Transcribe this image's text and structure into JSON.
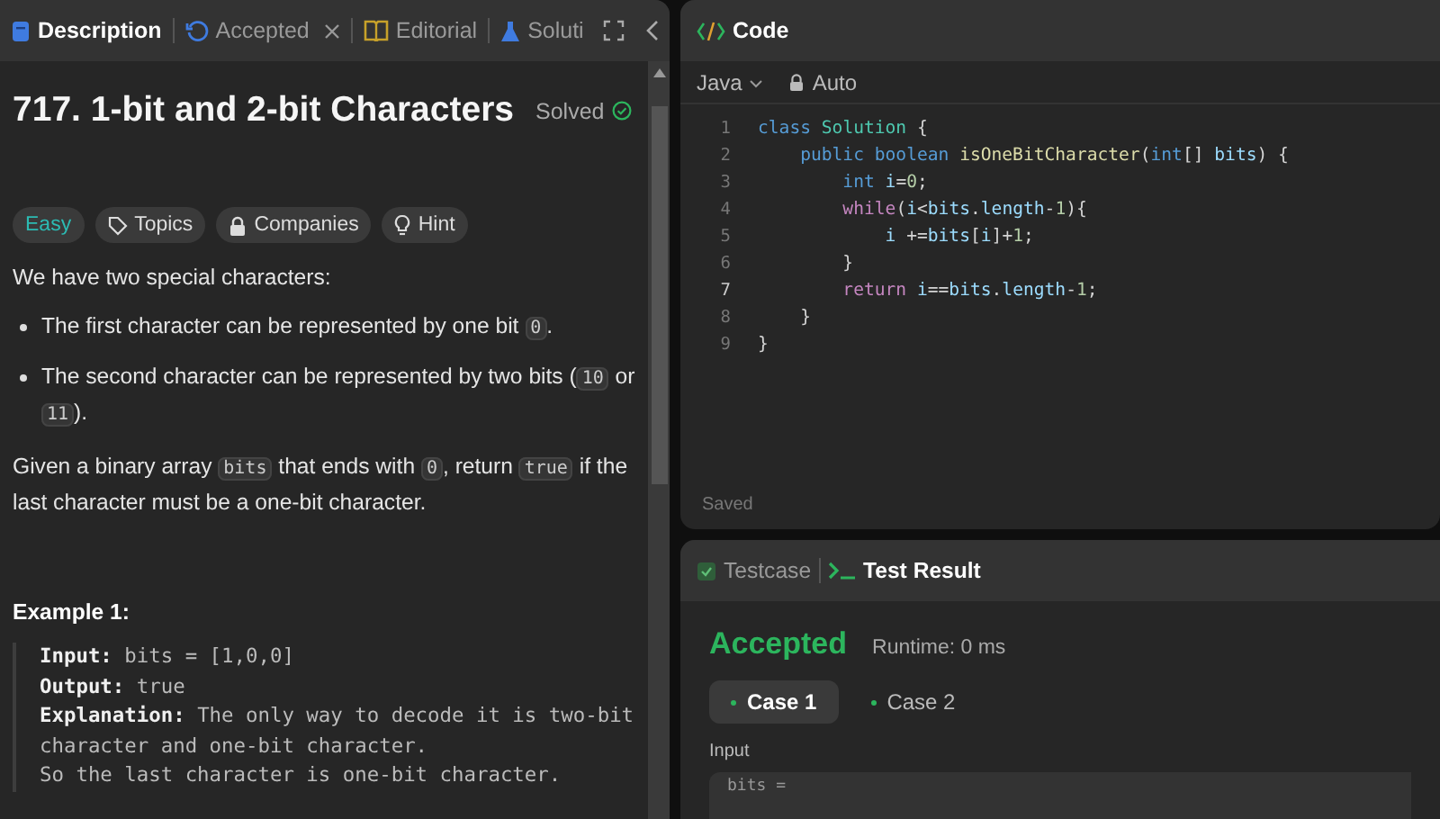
{
  "left_tabs": [
    {
      "label": "Description",
      "selected": true,
      "closable": false
    },
    {
      "label": "Accepted",
      "selected": false,
      "closable": true
    },
    {
      "label": "Editorial",
      "selected": false,
      "closable": false
    },
    {
      "label": "Soluti",
      "selected": false,
      "closable": false
    }
  ],
  "problem": {
    "title": "717. 1-bit and 2-bit Characters",
    "status": "Solved",
    "tags": [
      {
        "label": "Easy",
        "kind": "difficulty"
      },
      {
        "label": "Topics",
        "kind": "topics"
      },
      {
        "label": "Companies",
        "kind": "companies"
      },
      {
        "label": "Hint",
        "kind": "hint"
      }
    ],
    "intro": "We have two special characters:",
    "bullets": [
      [
        {
          "kind": "text",
          "text": "The first character can be represented by one bit "
        },
        {
          "kind": "code",
          "text": "0"
        },
        {
          "kind": "text",
          "text": "."
        }
      ],
      [
        {
          "kind": "text",
          "text": "The second character can be represented by two bits ("
        },
        {
          "kind": "code",
          "text": "10"
        },
        {
          "kind": "text",
          "text": " or "
        },
        {
          "kind": "code",
          "text": "11"
        },
        {
          "kind": "text",
          "text": ")."
        }
      ]
    ],
    "statement": [
      {
        "kind": "text",
        "text": "Given a binary array "
      },
      {
        "kind": "code",
        "text": "bits"
      },
      {
        "kind": "text",
        "text": " that ends with "
      },
      {
        "kind": "code",
        "text": "0"
      },
      {
        "kind": "text",
        "text": ", return "
      },
      {
        "kind": "code",
        "text": "true"
      },
      {
        "kind": "text",
        "text": " if the last character must be a one-bit character."
      }
    ],
    "example": {
      "title": "Example 1:",
      "lines": [
        "**Input:** bits = [1,0,0]",
        "**Output:** true",
        "**Explanation:** The only way to decode it is two-bit character and one-bit character.\nSo the last character is one-bit character."
      ]
    }
  },
  "code_panel": {
    "title": "Code",
    "language": "Java",
    "mode": "Auto",
    "status": "Saved",
    "lines": [
      {
        "number": "1",
        "current": false,
        "tokens": [
          {
            "kind": "keyword",
            "text": "class"
          },
          {
            "kind": "type",
            "text": " Solution"
          },
          {
            "kind": "plain",
            "text": " {"
          }
        ]
      },
      {
        "number": "2",
        "current": false,
        "tokens": [
          {
            "kind": "keyword",
            "text": "    public"
          },
          {
            "kind": "keyword",
            "text": " boolean"
          },
          {
            "kind": "func",
            "text": " isOneBitCharacter"
          },
          {
            "kind": "plain",
            "text": "("
          },
          {
            "kind": "keyword",
            "text": "int"
          },
          {
            "kind": "plain",
            "text": "[] "
          },
          {
            "kind": "var",
            "text": "bits"
          },
          {
            "kind": "plain",
            "text": ") {"
          }
        ]
      },
      {
        "number": "3",
        "current": false,
        "tokens": [
          {
            "kind": "keyword",
            "text": "        int"
          },
          {
            "kind": "var",
            "text": " i"
          },
          {
            "kind": "plain",
            "text": "="
          },
          {
            "kind": "number",
            "text": "0"
          },
          {
            "kind": "plain",
            "text": ";"
          }
        ]
      },
      {
        "number": "4",
        "current": false,
        "tokens": [
          {
            "kind": "control",
            "text": "        while"
          },
          {
            "kind": "plain",
            "text": "("
          },
          {
            "kind": "var",
            "text": "i"
          },
          {
            "kind": "plain",
            "text": "<"
          },
          {
            "kind": "var",
            "text": "bits"
          },
          {
            "kind": "plain",
            "text": "."
          },
          {
            "kind": "var",
            "text": "length"
          },
          {
            "kind": "plain",
            "text": "-"
          },
          {
            "kind": "number",
            "text": "1"
          },
          {
            "kind": "plain",
            "text": "){"
          }
        ]
      },
      {
        "number": "5",
        "current": false,
        "tokens": [
          {
            "kind": "var",
            "text": "            i"
          },
          {
            "kind": "plain",
            "text": " +="
          },
          {
            "kind": "var",
            "text": "bits"
          },
          {
            "kind": "plain",
            "text": "["
          },
          {
            "kind": "var",
            "text": "i"
          },
          {
            "kind": "plain",
            "text": "]+"
          },
          {
            "kind": "number",
            "text": "1"
          },
          {
            "kind": "plain",
            "text": ";"
          }
        ]
      },
      {
        "number": "6",
        "current": false,
        "tokens": [
          {
            "kind": "plain",
            "text": "        }"
          }
        ]
      },
      {
        "number": "7",
        "current": true,
        "tokens": [
          {
            "kind": "control",
            "text": "        return"
          },
          {
            "kind": "var",
            "text": " i"
          },
          {
            "kind": "plain",
            "text": "=="
          },
          {
            "kind": "var",
            "text": "bits"
          },
          {
            "kind": "plain",
            "text": "."
          },
          {
            "kind": "var",
            "text": "length"
          },
          {
            "kind": "plain",
            "text": "-"
          },
          {
            "kind": "number",
            "text": "1"
          },
          {
            "kind": "plain",
            "text": ";"
          }
        ]
      },
      {
        "number": "8",
        "current": false,
        "tokens": [
          {
            "kind": "plain",
            "text": "    }"
          }
        ]
      },
      {
        "number": "9",
        "current": false,
        "tokens": [
          {
            "kind": "plain",
            "text": "}"
          }
        ]
      }
    ]
  },
  "result_panel": {
    "tabs": [
      {
        "label": "Testcase",
        "selected": false
      },
      {
        "label": "Test Result",
        "selected": true
      }
    ],
    "verdict": "Accepted",
    "runtime": "Runtime: 0 ms",
    "cases": [
      {
        "label": "Case 1",
        "selected": true
      },
      {
        "label": "Case 2",
        "selected": false
      }
    ],
    "input_label": "Input",
    "input_value": "bits ="
  }
}
